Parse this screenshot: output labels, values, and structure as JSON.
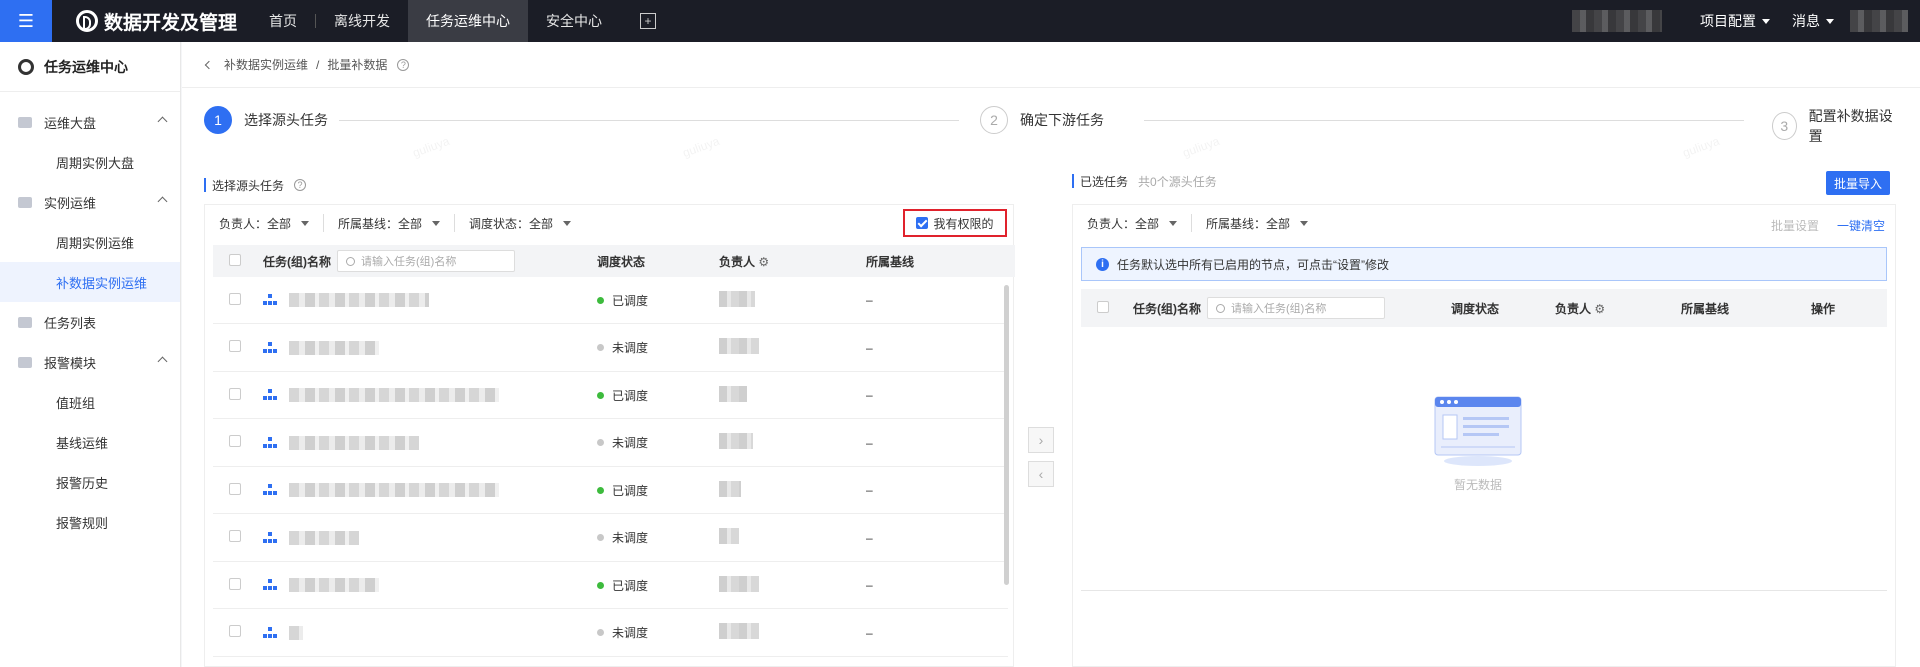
{
  "topbar": {
    "menu_icon": "hamburger-icon",
    "brand": "数据开发及管理",
    "nav": [
      {
        "label": "首页",
        "active": false
      },
      {
        "label": "离线开发",
        "active": false
      },
      {
        "label": "任务运维中心",
        "active": true
      },
      {
        "label": "安全中心",
        "active": false
      }
    ],
    "right": {
      "project_config": "项目配置",
      "messages": "消息"
    }
  },
  "sidebar": {
    "title": "任务运维中心",
    "groups": [
      {
        "label": "运维大盘",
        "items": [
          "周期实例大盘"
        ]
      },
      {
        "label": "实例运维",
        "items": [
          "周期实例运维",
          "补数据实例运维"
        ]
      },
      {
        "label": "任务列表",
        "items": []
      },
      {
        "label": "报警模块",
        "items": [
          "值班组",
          "基线运维",
          "报警历史",
          "报警规则"
        ]
      }
    ],
    "active_item": "补数据实例运维"
  },
  "breadcrumb": {
    "parent": "补数据实例运维",
    "current": "批量补数据"
  },
  "steps": [
    {
      "num": "1",
      "label": "选择源头任务",
      "active": true
    },
    {
      "num": "2",
      "label": "确定下游任务",
      "active": false
    },
    {
      "num": "3",
      "label": "配置补数据设置",
      "active": false
    }
  ],
  "left_panel": {
    "title": "选择源头任务",
    "filters": [
      {
        "label": "负责人：全部"
      },
      {
        "label": "所属基线：全部"
      },
      {
        "label": "调度状态：全部"
      }
    ],
    "permission_checkbox": {
      "label": "我有权限的",
      "checked": true
    },
    "columns": {
      "name": "任务(组)名称",
      "search_placeholder": "请输入任务(组)名称",
      "status": "调度状态",
      "owner": "负责人",
      "baseline": "所属基线"
    },
    "rows": [
      {
        "status": "已调度",
        "scheduled": true,
        "baseline": "–"
      },
      {
        "status": "未调度",
        "scheduled": false,
        "baseline": "–"
      },
      {
        "status": "已调度",
        "scheduled": true,
        "baseline": "–"
      },
      {
        "status": "未调度",
        "scheduled": false,
        "baseline": "–"
      },
      {
        "status": "已调度",
        "scheduled": true,
        "baseline": "–"
      },
      {
        "status": "未调度",
        "scheduled": false,
        "baseline": "–"
      },
      {
        "status": "已调度",
        "scheduled": true,
        "baseline": "–"
      },
      {
        "status": "未调度",
        "scheduled": false,
        "baseline": "–"
      }
    ]
  },
  "right_panel": {
    "title": "已选任务",
    "count": "共0个源头任务",
    "import_button": "批量导入",
    "filters": [
      {
        "label": "负责人：全部"
      },
      {
        "label": "所属基线：全部"
      }
    ],
    "batch_settings": "批量设置",
    "clear_all": "一键清空",
    "info": "任务默认选中所有已启用的节点，可点击“设置”修改",
    "columns": {
      "name": "任务(组)名称",
      "search_placeholder": "请输入任务(组)名称",
      "status": "调度状态",
      "owner": "负责人",
      "baseline": "所属基线",
      "action": "操作"
    },
    "empty": "暂无数据"
  },
  "colors": {
    "primary": "#2e6ff2",
    "highlight": "#e0222c",
    "scheduled": "#3dbb3d",
    "unscheduled": "#c8c8c8"
  }
}
